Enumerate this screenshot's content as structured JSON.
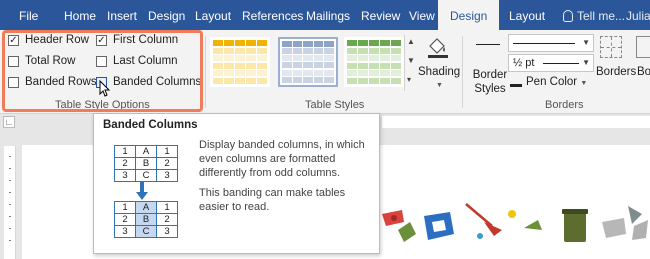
{
  "tabs": [
    "File",
    "Home",
    "Insert",
    "Design",
    "Layout",
    "References",
    "Mailings",
    "Review",
    "View",
    "Design",
    "Layout"
  ],
  "active_tab": "Design",
  "tell_me": "Tell me...",
  "user": "Julia",
  "table_style_options": {
    "label": "Table Style Options",
    "options": [
      {
        "label": "Header Row",
        "checked": true
      },
      {
        "label": "First Column",
        "checked": true
      },
      {
        "label": "Total Row",
        "checked": false
      },
      {
        "label": "Last Column",
        "checked": false
      },
      {
        "label": "Banded Rows",
        "checked": false
      },
      {
        "label": "Banded Columns",
        "checked": false
      }
    ]
  },
  "table_styles": {
    "label": "Table Styles",
    "thumbs": [
      {
        "name": "gold",
        "header": "#f0b400",
        "band": "#fbe7a7",
        "base": "#fdf3d2"
      },
      {
        "name": "blue-gray",
        "header": "#8ea3c5",
        "band": "#c9d3e4",
        "base": "#e2e8f1"
      },
      {
        "name": "green",
        "header": "#6aa84f",
        "band": "#c6e0b4",
        "base": "#e2efda"
      }
    ]
  },
  "shading": {
    "label": "Shading"
  },
  "borders": {
    "label": "Borders",
    "border_styles": "Border Styles",
    "weight": "½ pt",
    "pen_color": "Pen Color",
    "borders_button": "Borders",
    "painter": "Bo Pai"
  },
  "tooltip": {
    "title": "Banded Columns",
    "desc1": "Display banded columns, in which even columns are formatted differently from odd columns.",
    "desc2": "This banding can make tables easier to read.",
    "table_before": [
      [
        "1",
        "A",
        "1"
      ],
      [
        "2",
        "B",
        "2"
      ],
      [
        "3",
        "C",
        "3"
      ]
    ],
    "table_after": [
      [
        "1",
        "A",
        "1"
      ],
      [
        "2",
        "B",
        "2"
      ],
      [
        "3",
        "C",
        "3"
      ]
    ]
  },
  "colors": {
    "title_bar": "#2b579a",
    "highlight": "#f07c5a",
    "band": "#c5d8ef",
    "table_border": "#2e75b6"
  }
}
